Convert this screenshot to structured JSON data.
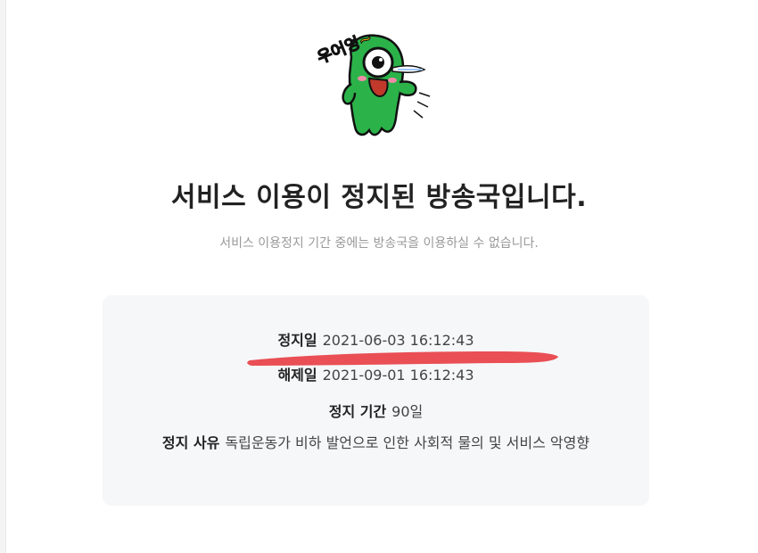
{
  "mascot": {
    "icon": "crying-green-monster-icon",
    "speech": "우어엉~",
    "colors": {
      "body": "#2bb34a",
      "outline": "#111111",
      "bubble": "#f5b800"
    }
  },
  "notice": {
    "title": "서비스 이용이 정지된 방송국입니다.",
    "subtitle": "서비스 이용정지 기간 중에는 방송국을 이용하실 수 없습니다."
  },
  "details": {
    "suspended_label": "정지일",
    "suspended_value": "2021-06-03 16:12:43",
    "release_label": "해제일",
    "release_value": "2021-09-01 16:12:43",
    "period_label": "정지 기간",
    "period_value": "90일",
    "reason_label": "정지 사유",
    "reason_value": "독립운동가 비하 발언으로 인한 사회적 물의 및 서비스 악영향"
  },
  "annotation": {
    "strike_color": "#e8464b"
  }
}
